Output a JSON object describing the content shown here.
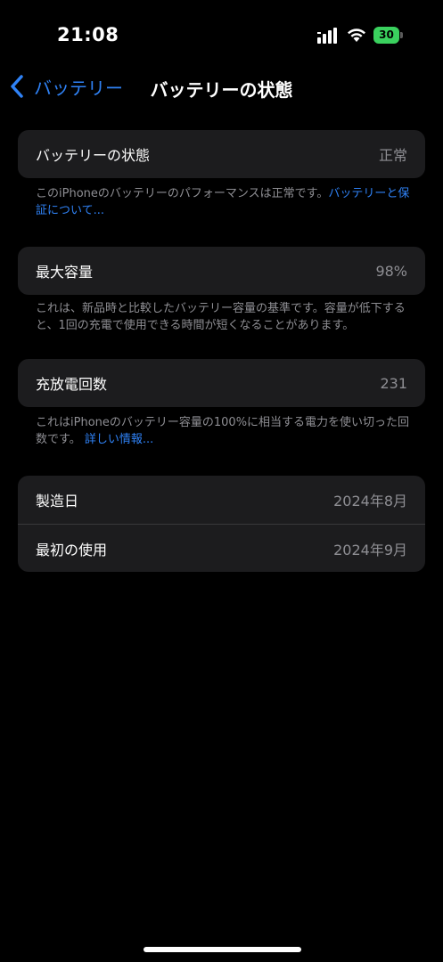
{
  "status_bar": {
    "time": "21:08",
    "battery_level": "30",
    "icons": [
      "cellular-signal-icon",
      "wifi-icon",
      "battery-charging-icon"
    ]
  },
  "nav": {
    "back_label": "バッテリー",
    "title": "バッテリーの状態"
  },
  "health": {
    "label": "バッテリーの状態",
    "value": "正常",
    "footer_text": "このiPhoneのバッテリーのパフォーマンスは正常です。",
    "footer_link": "バッテリーと保証について..."
  },
  "capacity": {
    "label": "最大容量",
    "value": "98%",
    "footer_text": "これは、新品時と比較したバッテリー容量の基準です。容量が低下すると、1回の充電で使用できる時間が短くなることがあります。"
  },
  "cycles": {
    "label": "充放電回数",
    "value": "231",
    "footer_text": "これはiPhoneのバッテリー容量の100%に相当する電力を使い切った回数です。",
    "footer_link": "詳しい情報..."
  },
  "dates": {
    "manufactured_label": "製造日",
    "manufactured_value": "2024年8月",
    "first_use_label": "最初の使用",
    "first_use_value": "2024年9月"
  },
  "colors": {
    "background": "#000000",
    "card": "#1c1c1e",
    "accent": "#2f82f6",
    "secondary_text": "#8e8e93",
    "battery_green": "#3ad15e"
  }
}
